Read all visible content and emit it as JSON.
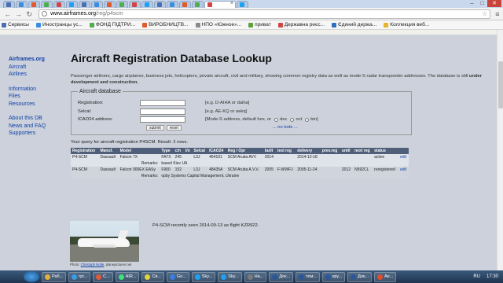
{
  "browser": {
    "tab_count": 18,
    "active_tab_close": "×",
    "window_controls": {
      "minimize": "–",
      "maximize": "□",
      "close": "✕"
    },
    "url_host": "www.airframes.org",
    "url_path": "/reg/p4scm",
    "bookmarks": [
      {
        "label": "Сервисы",
        "color": "#4a6fb3"
      },
      {
        "label": "Иностранцы ус...",
        "color": "#3b8de0"
      },
      {
        "label": "ФОНД ПІДТРИ...",
        "color": "#4fae4c"
      },
      {
        "label": "ВИРОБНИЦТВ...",
        "color": "#e05a2b"
      },
      {
        "label": "НПО «Южное»...",
        "color": "#8a8a8a"
      },
      {
        "label": "приват",
        "color": "#5ca33d"
      },
      {
        "label": "Державна реєс...",
        "color": "#d04545"
      },
      {
        "label": "Єдиний держа...",
        "color": "#2f6fc0"
      },
      {
        "label": "Коллекция веб...",
        "color": "#e8b52a"
      }
    ]
  },
  "sidebar": {
    "brand": "Airframes.org",
    "links_group1": [
      "Aircraft",
      "Airlines"
    ],
    "links_group2": [
      "Information",
      "Files",
      "Resources"
    ],
    "links_group3": [
      "About this DB",
      "News and FAQ",
      "Supporters"
    ]
  },
  "page": {
    "title": "Aircraft Registration Database Lookup",
    "intro": "Passenger airliners, cargo airplanes, business jets, helicopters, private aircraft, civil and military, showing common registry data as well as mode-S radar transponder addresses. The database is still ",
    "intro_bold": "under development and construction."
  },
  "search": {
    "legend": "Aircraft database",
    "fields": [
      {
        "label": "Registration:",
        "hint": "[e.g. D-AIHA or daiha]"
      },
      {
        "label": "Selcal:",
        "hint": "[e.g. AE-KQ or aekq]"
      },
      {
        "label": "ICAO24 address:",
        "hint": "[Mode-S address, default hex, or"
      }
    ],
    "radio_dec": "dec",
    "radio_oct": "oct",
    "radio_bin": "bin",
    "radio_end": "]",
    "submit": "submit",
    "reset": "reset",
    "no_bots": "... no bots ..."
  },
  "results": {
    "summary": "Your query for aircraft registration P4SCM. Result: 2 rows.",
    "columns": [
      "Registration",
      "Manuf.",
      "Model",
      "Type",
      "c/n",
      "l/n",
      "Selcal",
      "ICAO24",
      "Reg / Opr",
      "built",
      "test reg",
      "delivery",
      "prev.reg",
      "until",
      "next reg",
      "status",
      ""
    ],
    "rows": [
      {
        "cells": [
          "P4-SCM",
          "Dassault",
          "Falcon 7X",
          "FA7X",
          "245",
          "",
          "L3J",
          "464101",
          "SCM Aruba AVV",
          "2014",
          "",
          "2014-12-18",
          "",
          "",
          "",
          "active",
          "edit"
        ],
        "remarks_label": "Remarks:",
        "remarks": "based Kiev UA"
      },
      {
        "cells": [
          "P4-SCM",
          "Dassault",
          "Falcon 900EX EASy",
          "F900",
          "152",
          "",
          "L3J",
          "48435A",
          "SCM Aruba A.V.V.",
          "2005",
          "F-WWFJ",
          "2005-11-24",
          "",
          "2012",
          "N592CL",
          "reregistered",
          "edit"
        ],
        "remarks_label": "Remarks:",
        "remarks": "opby Systems Capital Management, Ukraine"
      }
    ],
    "photo_credit_prefix": "Photo: ",
    "photo_credit_name": "Christoph Nolte",
    "photo_credit_site": ", planepictures.net",
    "last_seen": "P4-SCM recently seen 2014-09-13 as flight KZR922."
  },
  "taskbar": {
    "items": [
      {
        "label": "Раб...",
        "color": "#e2b13c"
      },
      {
        "label": "грі...",
        "color": "#3c9be2"
      },
      {
        "label": "С...",
        "color": "#e25a3c"
      },
      {
        "label": "AIR...",
        "color": "#3ce27a"
      },
      {
        "label": "Св...",
        "color": "#e2d23c"
      },
      {
        "label": "Go...",
        "color": "#3c7de2"
      },
      {
        "label": "Sky...",
        "color": "#1da1f2"
      },
      {
        "label": "Sky...",
        "color": "#1da1f2"
      },
      {
        "label": "Ha...",
        "color": "#7a7a7a"
      },
      {
        "label": "Док...",
        "color": "#2b579a"
      },
      {
        "label": "тем...",
        "color": "#2b579a"
      },
      {
        "label": "кру...",
        "color": "#2b579a"
      },
      {
        "label": "Док...",
        "color": "#2b579a"
      },
      {
        "label": "Ae...",
        "color": "#e04e2b"
      }
    ],
    "lang": "RU",
    "time": "17:30"
  }
}
